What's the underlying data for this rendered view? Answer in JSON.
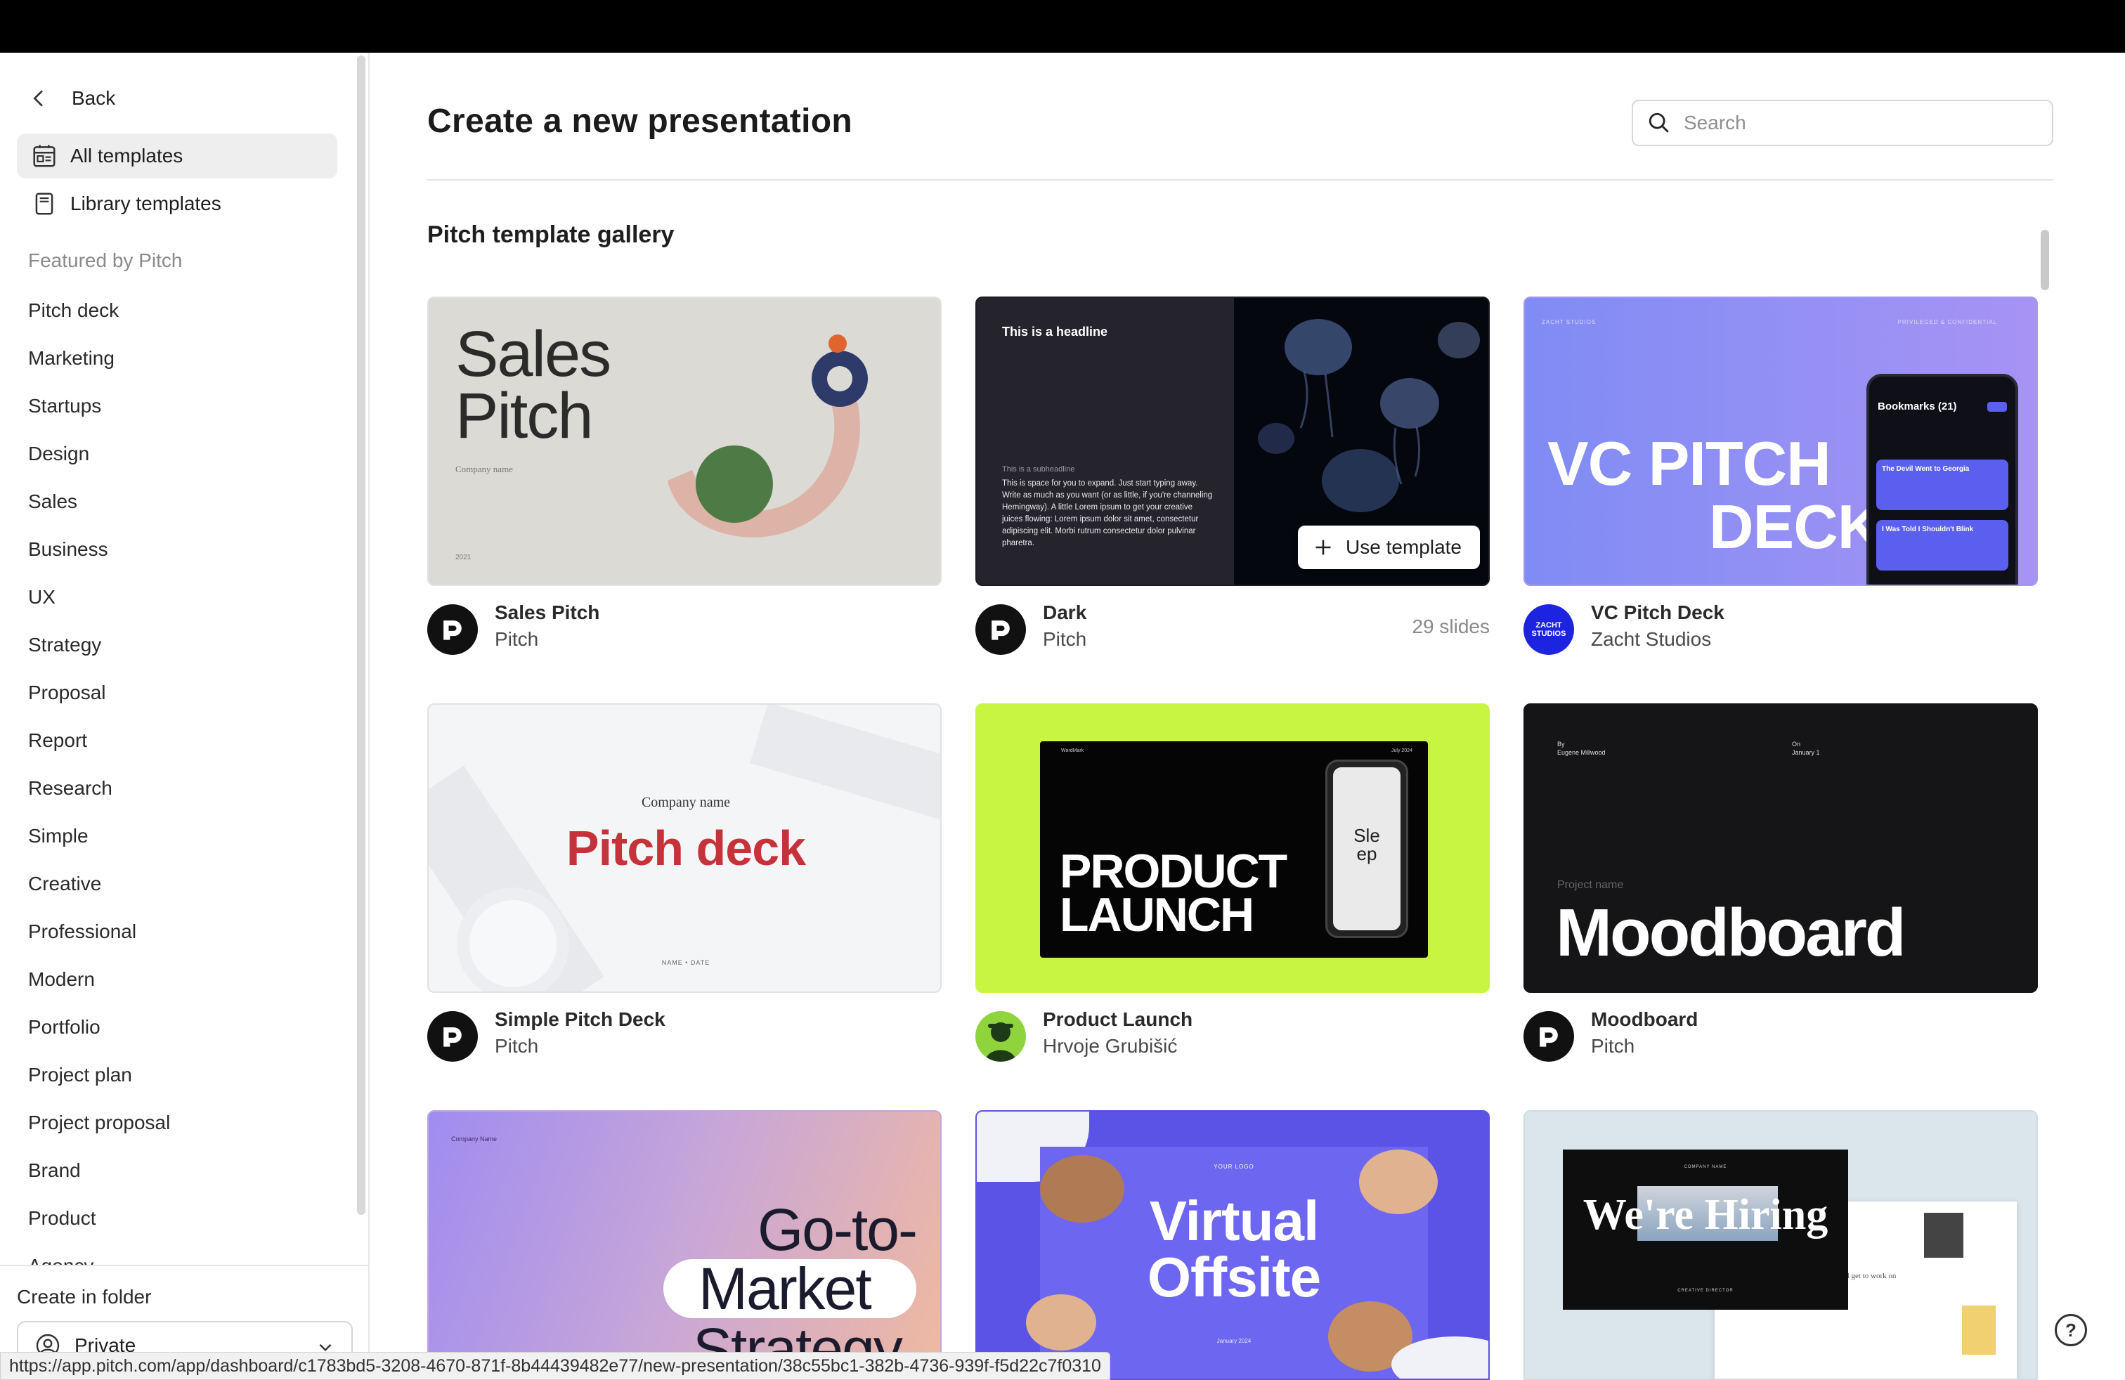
{
  "sidebar": {
    "back_label": "Back",
    "nav": [
      {
        "label": "All templates",
        "icon": "templates-icon",
        "active": true
      },
      {
        "label": "Library templates",
        "icon": "library-icon",
        "active": false
      }
    ],
    "section_label": "Featured by Pitch",
    "categories": [
      "Pitch deck",
      "Marketing",
      "Startups",
      "Design",
      "Sales",
      "Business",
      "UX",
      "Strategy",
      "Proposal",
      "Report",
      "Research",
      "Simple",
      "Creative",
      "Professional",
      "Modern",
      "Portfolio",
      "Project plan",
      "Project proposal",
      "Brand",
      "Product",
      "Agency"
    ],
    "folder_label": "Create in folder",
    "folder_value": "Private"
  },
  "main": {
    "title": "Create a new presentation",
    "search_placeholder": "Search",
    "gallery_title": "Pitch template gallery",
    "use_template_label": "Use template"
  },
  "cards": [
    {
      "name": "Sales Pitch",
      "author": "Pitch",
      "thumb": {
        "title1": "Sales",
        "title2": "Pitch",
        "company": "Company name",
        "year": "2021"
      }
    },
    {
      "name": "Dark",
      "author": "Pitch",
      "slides": "29 slides",
      "thumb": {
        "headline": "This is a headline",
        "subheadline": "This is a subheadline",
        "body": "This is space for you to expand. Just start typing away. Write as much as you want (or as little, if you're channeling Hemingway). A little Lorem ipsum to get your creative juices flowing: Lorem ipsum dolor sit amet, consectetur adipiscing elit. Morbi rutrum consectetur dolor pulvinar pharetra."
      }
    },
    {
      "name": "VC Pitch Deck",
      "author": "Zacht Studios",
      "thumb": {
        "brand": "ZACHT STUDIOS",
        "confidential": "PRIVILEGED & CONFIDENTIAL",
        "line1": "VC PITCH",
        "line2": "DECK",
        "phone_title": "Bookmarks (21)",
        "phone_item1": "The Devil Went to Georgia",
        "phone_item2": "I Was Told I Shouldn't Blink",
        "avatar_text1": "ZACHT",
        "avatar_text2": "STUDIOS"
      }
    },
    {
      "name": "Simple Pitch Deck",
      "author": "Pitch",
      "thumb": {
        "company": "Company name",
        "title": "Pitch deck",
        "footer": "NAME  •  DATE"
      }
    },
    {
      "name": "Product Launch",
      "author": "Hrvoje Grubišić",
      "thumb": {
        "line1": "PRODUCT",
        "line2": "LAUNCH",
        "phone1": "Sle",
        "phone2": "ep",
        "top_left": "WordMark",
        "top_right": "July 2024"
      }
    },
    {
      "name": "Moodboard",
      "author": "Pitch",
      "thumb": {
        "by_label": "By",
        "by_value": "Eugene Millwood",
        "on_label": "On",
        "on_value": "January 1",
        "project": "Project name",
        "title": "Moodboard"
      }
    },
    {
      "name": "Go-to-Market Strategy",
      "thumb": {
        "company": "Company Name",
        "line1": "Go-to-",
        "line2": "Market",
        "line3": "Strategy"
      }
    },
    {
      "name": "Virtual Offsite",
      "thumb": {
        "logo": "YOUR LOGO",
        "line1": "Virtual",
        "line2": "Offsite",
        "date": "January 2024"
      }
    },
    {
      "name": "We're Hiring",
      "thumb": {
        "company": "COMPANY NAME",
        "title": "We're Hiring",
        "sub": "CREATIVE DIRECTOR",
        "side_text": "I'll get to work on"
      }
    }
  ],
  "status_url": "https://app.pitch.com/app/dashboard/c1783bd5-3208-4670-871f-8b44439482e77/new-presentation/38c55bc1-382b-4736-939f-f5d22c7f0310",
  "help_label": "?",
  "colors": {
    "accent_green": "#c8f542",
    "vc_purple": "#8f7cf5",
    "pitch_red": "#c6323a",
    "gtm_gradient_start": "#9f8cf0",
    "gtm_gradient_end": "#f0b9a0"
  }
}
